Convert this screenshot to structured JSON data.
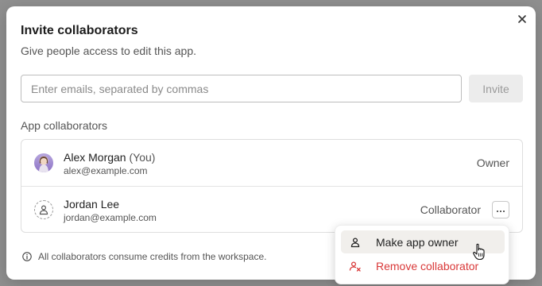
{
  "dialog": {
    "title": "Invite collaborators",
    "subtitle": "Give people access to edit this app.",
    "close_icon": "close-icon"
  },
  "invite": {
    "placeholder": "Enter emails, separated by commas",
    "value": "",
    "button_label": "Invite"
  },
  "collaborators": {
    "section_label": "App collaborators",
    "items": [
      {
        "name": "Alex Morgan",
        "suffix": "(You)",
        "email": "alex@example.com",
        "role": "Owner",
        "avatar": "photo"
      },
      {
        "name": "Jordan Lee",
        "suffix": "",
        "email": "jordan@example.com",
        "role": "Collaborator",
        "avatar": "person-placeholder-icon"
      }
    ]
  },
  "footer": {
    "note": "All collaborators consume credits from the workspace.",
    "icon": "info-icon"
  },
  "context_menu": {
    "items": [
      {
        "label": "Make app owner",
        "icon": "person-icon"
      },
      {
        "label": "Remove collaborator",
        "icon": "remove-person-icon",
        "color": "#d93838"
      }
    ]
  }
}
